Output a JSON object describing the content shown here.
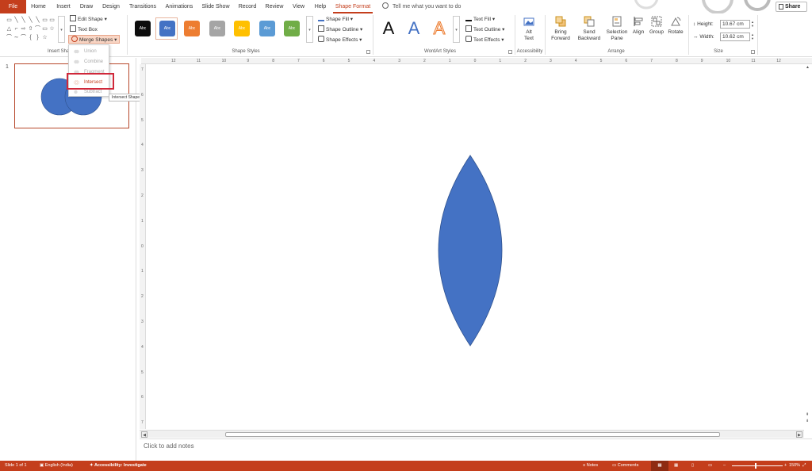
{
  "tabs": [
    {
      "label": "File"
    },
    {
      "label": "Home"
    },
    {
      "label": "Insert"
    },
    {
      "label": "Draw"
    },
    {
      "label": "Design"
    },
    {
      "label": "Transitions"
    },
    {
      "label": "Animations"
    },
    {
      "label": "Slide Show"
    },
    {
      "label": "Record"
    },
    {
      "label": "Review"
    },
    {
      "label": "View"
    },
    {
      "label": "Help"
    },
    {
      "label": "Shape Format"
    }
  ],
  "tell_me": "Tell me what you want to do",
  "share": "Share",
  "ribbon": {
    "insert_shapes": {
      "label": "Insert Sha",
      "edit_shape": "Edit Shape",
      "text_box": "Text Box",
      "merge_shapes": "Merge Shapes"
    },
    "shape_styles": {
      "label": "Shape Styles",
      "swatches": [
        {
          "text": "Abc",
          "color": "#0d0d0d"
        },
        {
          "text": "Abc",
          "color": "#4472c4"
        },
        {
          "text": "Abc",
          "color": "#ed7d31"
        },
        {
          "text": "Abc",
          "color": "#a5a5a5"
        },
        {
          "text": "Abc",
          "color": "#ffc000"
        },
        {
          "text": "Abc",
          "color": "#5b9bd5"
        },
        {
          "text": "Abc",
          "color": "#70ad47"
        }
      ],
      "shape_fill": "Shape Fill",
      "shape_outline": "Shape Outline",
      "shape_effects": "Shape Effects"
    },
    "wordart": {
      "label": "WordArt Styles",
      "letters": [
        "A",
        "A",
        "A"
      ],
      "text_fill": "Text Fill",
      "text_outline": "Text Outline",
      "text_effects": "Text Effects"
    },
    "accessibility": {
      "label": "Accessibility",
      "alt_text_line1": "Alt",
      "alt_text_line2": "Text"
    },
    "arrange": {
      "label": "Arrange",
      "bring_forward_1": "Bring",
      "bring_forward_2": "Forward",
      "send_backward_1": "Send",
      "send_backward_2": "Backward",
      "selection_pane_1": "Selection",
      "selection_pane_2": "Pane",
      "align": "Align",
      "group": "Group",
      "rotate": "Rotate"
    },
    "size": {
      "label": "Size",
      "height_label": "Height:",
      "height_value": "10.67 cm",
      "width_label": "Width:",
      "width_value": "10.62 cm"
    }
  },
  "merge_menu": {
    "items": [
      {
        "label": "Union",
        "enabled": false
      },
      {
        "label": "Combine",
        "enabled": false
      },
      {
        "label": "Fragment",
        "enabled": false
      },
      {
        "label": "Intersect",
        "enabled": true
      },
      {
        "label": "Subtract",
        "enabled": false
      }
    ],
    "tooltip": "Intersect Shapes"
  },
  "slide_panel": {
    "slide_number": "1"
  },
  "ruler": {
    "h_ticks": [
      "12",
      "11",
      "10",
      "9",
      "8",
      "7",
      "6",
      "5",
      "4",
      "3",
      "2",
      "1",
      "0",
      "1",
      "2",
      "3",
      "4",
      "5",
      "6",
      "7",
      "8",
      "9",
      "10",
      "11",
      "12"
    ],
    "v_ticks": [
      "7",
      "6",
      "5",
      "4",
      "3",
      "2",
      "1",
      "0",
      "1",
      "2",
      "3",
      "4",
      "5",
      "6",
      "7"
    ]
  },
  "shape_color": "#4472c4",
  "shape_outline_color": "#2f528f",
  "notes_placeholder": "Click to add notes",
  "status": {
    "slide": "Slide 1 of 1",
    "language": "English (India)",
    "accessibility": "Accessibility: Investigate",
    "notes": "Notes",
    "comments": "Comments",
    "zoom": "150%",
    "zoom_level": 0.47,
    "minus": "–",
    "plus": "+"
  }
}
